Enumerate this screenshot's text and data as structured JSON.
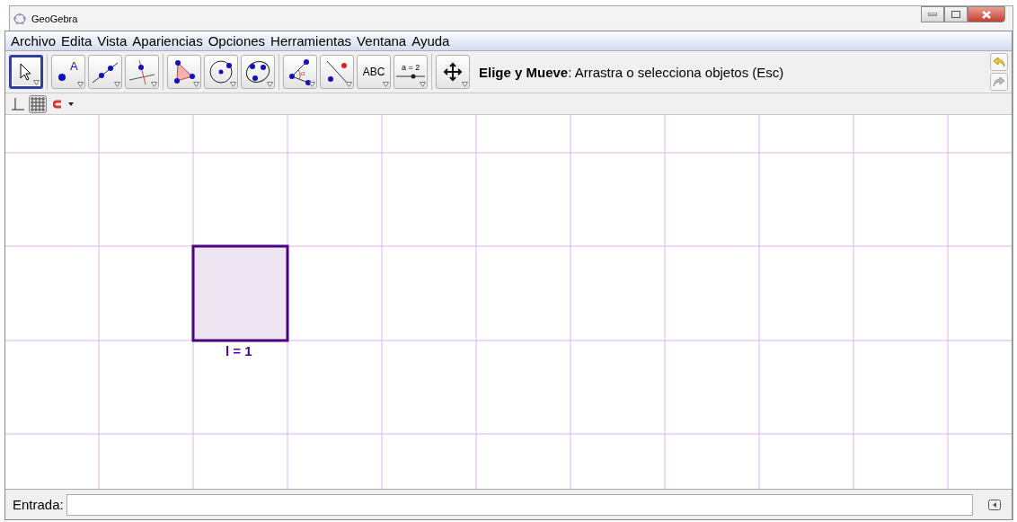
{
  "window": {
    "title": "GeoGebra"
  },
  "menu": [
    "Archivo",
    "Edita",
    "Vista",
    "Apariencias",
    "Opciones",
    "Herramientas",
    "Ventana",
    "Ayuda"
  ],
  "toolbar": {
    "groups": [
      [
        {
          "kind": "move",
          "selected": true
        }
      ],
      [
        {
          "kind": "point",
          "selected": false,
          "label": "A"
        },
        {
          "kind": "line",
          "selected": false
        },
        {
          "kind": "perpendicular",
          "selected": false
        }
      ],
      [
        {
          "kind": "polygon",
          "selected": false
        },
        {
          "kind": "circle",
          "selected": false
        },
        {
          "kind": "conic",
          "selected": false
        }
      ],
      [
        {
          "kind": "angle",
          "selected": false,
          "label": "α"
        },
        {
          "kind": "reflect",
          "selected": false
        },
        {
          "kind": "text",
          "selected": false,
          "label": "ABC"
        },
        {
          "kind": "slider",
          "selected": false,
          "label": "a = 2"
        }
      ],
      [
        {
          "kind": "pan",
          "selected": false
        }
      ]
    ],
    "help_title": "Elige y Mueve",
    "help_text": ": Arrastra o selecciona objetos (Esc)"
  },
  "style_bar": {
    "axes": false,
    "grid": true
  },
  "graphics": {
    "square": {
      "color": "#4b0082",
      "label": "l = 1"
    }
  },
  "input_bar": {
    "label": "Entrada:"
  }
}
